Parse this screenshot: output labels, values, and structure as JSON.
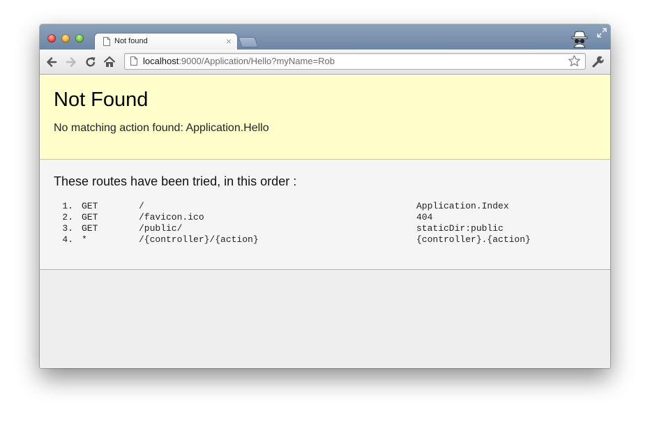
{
  "tab": {
    "title": "Not found",
    "close_label": "×"
  },
  "toolbar": {
    "url_host": "localhost",
    "url_rest": ":9000/Application/Hello?myName=Rob",
    "icons": [
      "back-arrow-icon",
      "forward-arrow-icon",
      "reload-icon",
      "home-icon",
      "page-icon",
      "star-icon",
      "wrench-icon"
    ]
  },
  "error": {
    "title": "Not Found",
    "message": "No matching action found: Application.Hello"
  },
  "routes": {
    "heading": "These routes have been tried, in this order :",
    "items": [
      {
        "num": "1.",
        "method": "GET",
        "path": "/",
        "action": "Application.Index"
      },
      {
        "num": "2.",
        "method": "GET",
        "path": "/favicon.ico",
        "action": "404"
      },
      {
        "num": "3.",
        "method": "GET",
        "path": "/public/",
        "action": "staticDir:public"
      },
      {
        "num": "4.",
        "method": "*",
        "path": "/{controller}/{action}",
        "action": "{controller}.{action}"
      }
    ]
  },
  "colors": {
    "error_background": "#ffffcc",
    "routes_background": "#f5f5f5",
    "tabstrip": "#7890ad"
  }
}
